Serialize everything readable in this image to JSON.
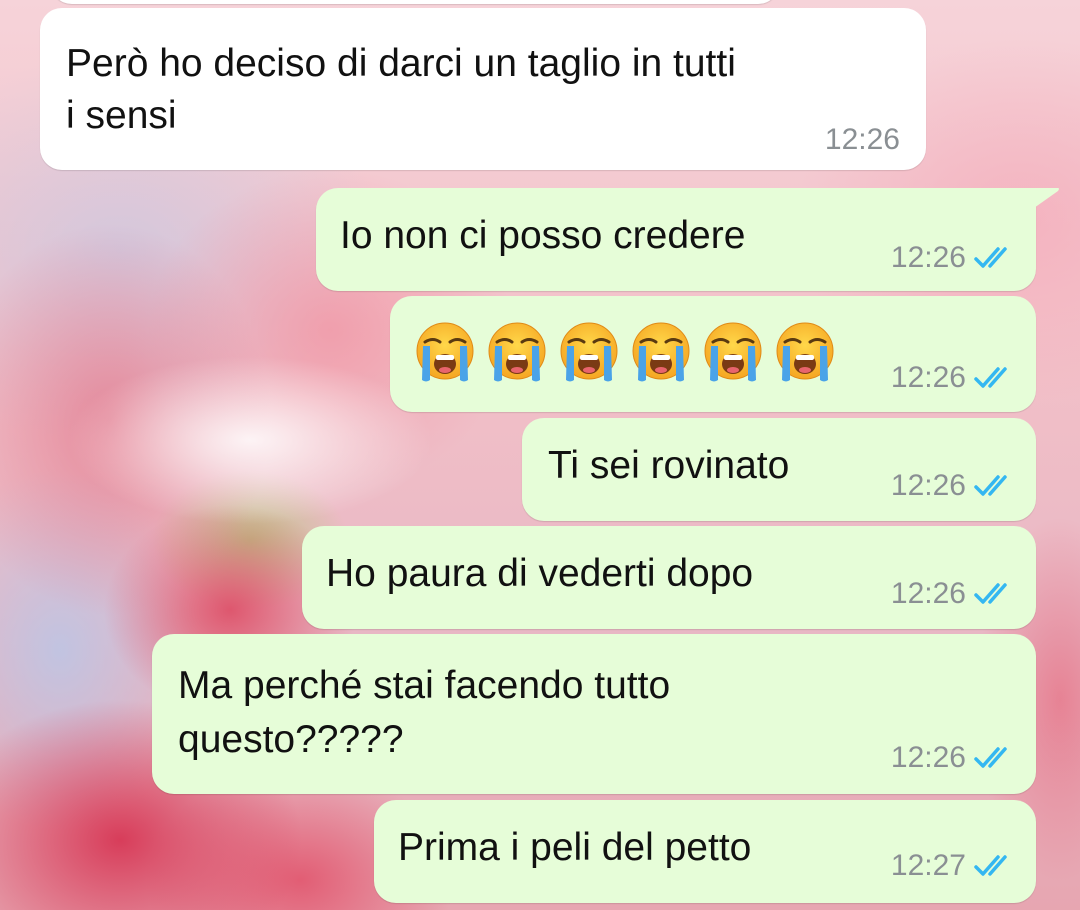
{
  "chat": {
    "messages": [
      {
        "direction": "incoming",
        "text_lines": [
          "Però ho deciso di darci un taglio in tutti",
          "i sensi"
        ],
        "time": "12:26"
      },
      {
        "direction": "outgoing",
        "text": "Io non ci posso credere",
        "time": "12:26",
        "status": "read"
      },
      {
        "direction": "outgoing",
        "emoji": "loudly-crying-face",
        "emoji_count": 6,
        "time": "12:26",
        "status": "read"
      },
      {
        "direction": "outgoing",
        "text": "Ti sei rovinato",
        "time": "12:26",
        "status": "read"
      },
      {
        "direction": "outgoing",
        "text": "Ho paura di vederti dopo",
        "time": "12:26",
        "status": "read"
      },
      {
        "direction": "outgoing",
        "text_lines": [
          "Ma perché stai facendo tutto",
          "questo?????"
        ],
        "time": "12:26",
        "status": "read"
      },
      {
        "direction": "outgoing",
        "text": "Prima i peli del petto",
        "time": "12:27",
        "status": "read"
      }
    ]
  },
  "colors": {
    "incoming_bubble": "#ffffff",
    "outgoing_bubble": "#e6fdd8",
    "read_ticks": "#34b7f1",
    "timestamp": "#8a8f93"
  },
  "icons": {
    "read_receipt": "double-check-icon",
    "emoji": "loudly-crying-face-emoji"
  }
}
